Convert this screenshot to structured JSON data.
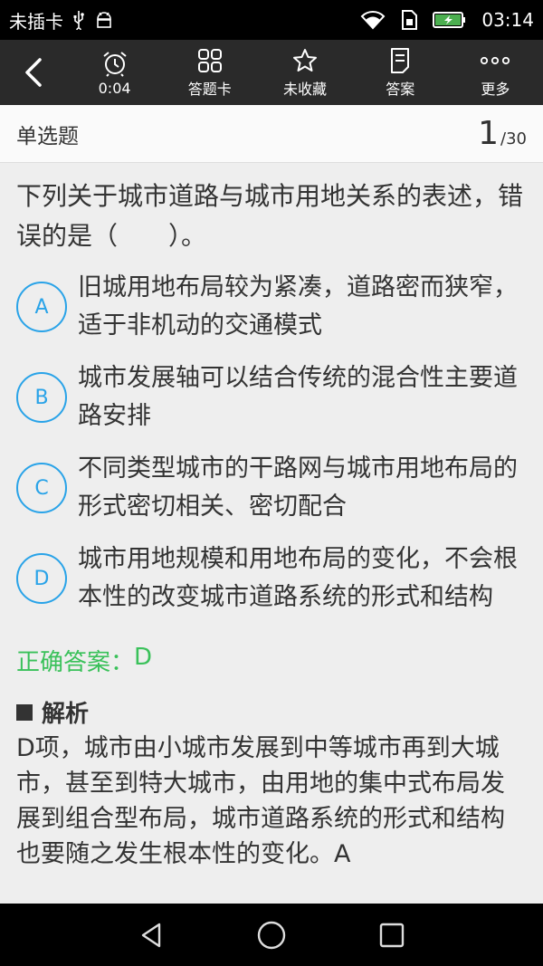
{
  "statusbar": {
    "carrier": "未插卡",
    "time": "03:14",
    "icons": [
      "usb-icon",
      "android-debug-icon",
      "wifi-icon",
      "sim-icon",
      "battery-charging-icon"
    ]
  },
  "toolbar": {
    "timer": "0:04",
    "answer_card": "答题卡",
    "favorite": "未收藏",
    "answer": "答案",
    "more": "更多"
  },
  "header": {
    "type": "单选题",
    "current": "1",
    "total": "/30"
  },
  "question": {
    "text": "下列关于城市道路与城市用地关系的表述，错误的是（　　）。",
    "options": [
      {
        "letter": "A",
        "text": "旧城用地布局较为紧凑，道路密而狭窄，适于非机动的交通模式"
      },
      {
        "letter": "B",
        "text": "城市发展轴可以结合传统的混合性主要道路安排"
      },
      {
        "letter": "C",
        "text": "不同类型城市的干路网与城市用地布局的形式密切相关、密切配合"
      },
      {
        "letter": "D",
        "text": "城市用地规模和用地布局的变化，不会根本性的改变城市道路系统的形式和结构"
      }
    ]
  },
  "answer": {
    "label": "正确答案：",
    "value": "D"
  },
  "analysis": {
    "title": "解析",
    "text": "D项，城市由小城市发展到中等城市再到大城市，甚至到特大城市，由用地的集中式布局发展到组合型布局，城市道路系统的形式和结构也要随之发生根本性的变化。A"
  },
  "colors": {
    "accent": "#29a3e8",
    "correct": "#3ac15a",
    "toolbar_bg": "#2a2a2a",
    "page_bg": "#eeeeee"
  }
}
